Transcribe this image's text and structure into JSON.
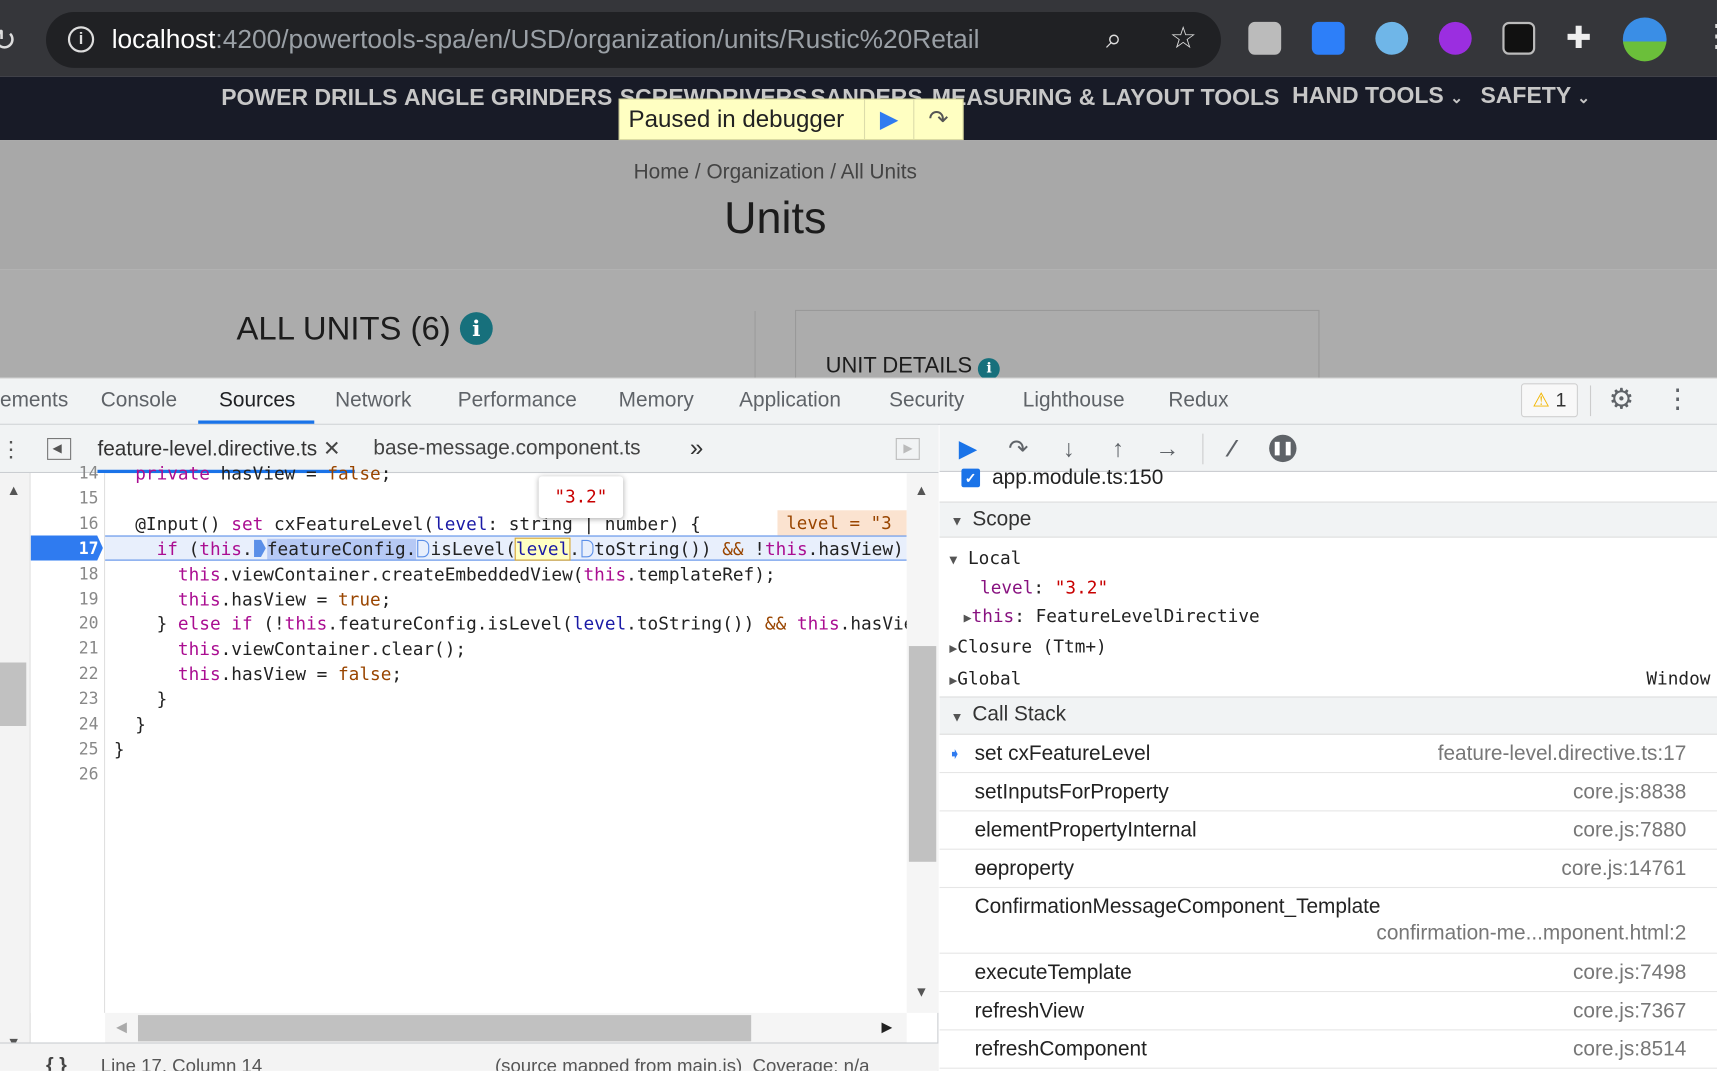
{
  "browser": {
    "url_host": "localhost",
    "url_rest": ":4200/powertools-spa/en/USD/organization/units/Rustic%20Retail",
    "icons": [
      "reload-icon",
      "info-icon",
      "zoom-out-icon",
      "star-icon",
      "extension-icon",
      "puzzle-icon",
      "profile-avatar",
      "menu-icon"
    ]
  },
  "site": {
    "nav": [
      "POWER DRILLS",
      "ANGLE GRINDERS",
      "SCREWDRIVERS",
      "SANDERS",
      "MEASURING & LAYOUT TOOLS",
      "HAND TOOLS",
      "SAFETY"
    ],
    "paused_label": "Paused in debugger",
    "breadcrumb": "Home / Organization / All Units",
    "title": "Units",
    "all_units": "ALL UNITS (6)",
    "unit_details": "UNIT DETAILS",
    "info_glyph": "i"
  },
  "devtools": {
    "tabs": [
      "ements",
      "Console",
      "Sources",
      "Network",
      "Performance",
      "Memory",
      "Application",
      "Security",
      "Lighthouse",
      "Redux"
    ],
    "active_tab": "Sources",
    "warning_count": "1",
    "file_tabs": [
      "feature-level.directive.ts",
      "base-message.component.ts"
    ],
    "active_file": "feature-level.directive.ts",
    "close_glyph": "✕",
    "more_glyph": "»",
    "line_numbers": [
      "14",
      "15",
      "16",
      "17",
      "18",
      "19",
      "20",
      "21",
      "22",
      "23",
      "24",
      "25",
      "26"
    ],
    "current_line": "17",
    "tooltip_value": "\"3.2\"",
    "inline_value": "level = \"3",
    "status": {
      "position": "Line 17, Column 14",
      "mapped": "(source mapped from main.js)  Coverage: n/a",
      "format_glyph": "{ }"
    },
    "breakpoint": {
      "label": "app.module.ts:150",
      "checked": true
    },
    "scope": {
      "header": "Scope",
      "local": "Local",
      "level_key": "level",
      "level_value": "\"3.2\"",
      "this_key": "this",
      "this_value": "FeatureLevelDirective",
      "closure": "Closure (Ttm+)",
      "global": "Global",
      "global_value": "Window"
    },
    "call_stack": {
      "header": "Call Stack",
      "frames": [
        {
          "fn": "set cxFeatureLevel",
          "loc": "feature-level.directive.ts:17"
        },
        {
          "fn": "setInputsForProperty",
          "loc": "core.js:8838"
        },
        {
          "fn": "elementPropertyInternal",
          "loc": "core.js:7880"
        },
        {
          "fn": "ɵɵproperty",
          "loc": "core.js:14761"
        },
        {
          "fn": "ConfirmationMessageComponent_Template",
          "loc": "confirmation-me...mponent.html:2"
        },
        {
          "fn": "executeTemplate",
          "loc": "core.js:7498"
        },
        {
          "fn": "refreshView",
          "loc": "core.js:7367"
        },
        {
          "fn": "refreshComponent",
          "loc": "core.js:8514"
        }
      ]
    }
  },
  "code_lines": [
    [
      [
        "  "
      ],
      [
        "private",
        "kw"
      ],
      [
        " hasView = "
      ],
      [
        "false",
        "lit"
      ],
      [
        ";"
      ]
    ],
    [
      [
        ""
      ]
    ],
    [
      [
        "  @Input() "
      ],
      [
        "set",
        "kw"
      ],
      [
        " cxFeatureLevel("
      ],
      [
        "level",
        "var"
      ],
      [
        ": string | number) {"
      ]
    ],
    [
      [
        "    "
      ],
      [
        "if",
        "kw"
      ],
      [
        " ("
      ],
      [
        "this",
        "kw"
      ],
      [
        "."
      ],
      [
        "",
        "bp"
      ],
      [
        "featureConfig.",
        "sel"
      ],
      [
        "",
        "bpo"
      ],
      [
        "isLevel("
      ],
      [
        "level",
        "word"
      ],
      [
        "."
      ],
      [
        "",
        "bpo"
      ],
      [
        "toString()) "
      ],
      [
        "&&",
        "op"
      ],
      [
        " !"
      ],
      [
        "this",
        "kw"
      ],
      [
        ".hasView) {"
      ]
    ],
    [
      [
        "      "
      ],
      [
        "this",
        "kw"
      ],
      [
        ".viewContainer.createEmbeddedView("
      ],
      [
        "this",
        "kw"
      ],
      [
        ".templateRef);"
      ]
    ],
    [
      [
        "      "
      ],
      [
        "this",
        "kw"
      ],
      [
        ".hasView = "
      ],
      [
        "true",
        "lit"
      ],
      [
        ";"
      ]
    ],
    [
      [
        "    } "
      ],
      [
        "else",
        "kw"
      ],
      [
        " "
      ],
      [
        "if",
        "kw"
      ],
      [
        " (!"
      ],
      [
        "this",
        "kw"
      ],
      [
        ".featureConfig.isLevel("
      ],
      [
        "level",
        "var"
      ],
      [
        ".toString()) "
      ],
      [
        "&&",
        "op"
      ],
      [
        " "
      ],
      [
        "this",
        "kw"
      ],
      [
        ".hasView) {"
      ]
    ],
    [
      [
        "      "
      ],
      [
        "this",
        "kw"
      ],
      [
        ".viewContainer.clear();"
      ]
    ],
    [
      [
        "      "
      ],
      [
        "this",
        "kw"
      ],
      [
        ".hasView = "
      ],
      [
        "false",
        "lit"
      ],
      [
        ";"
      ]
    ],
    [
      [
        "    }"
      ]
    ],
    [
      [
        "  }"
      ]
    ],
    [
      [
        "}"
      ]
    ],
    [
      [
        ""
      ]
    ]
  ],
  "colors": {
    "accent": "#1a73e8",
    "exec_line": "#2f7bf0",
    "paused_bg": "#ffffc2",
    "info_badge": "#17707c"
  }
}
